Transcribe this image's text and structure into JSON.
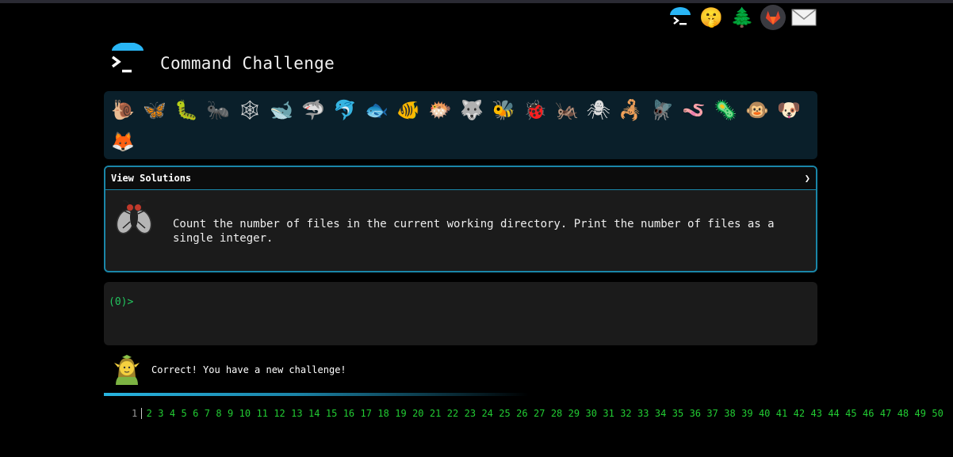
{
  "header": {
    "title": "Command Challenge",
    "top_icons": [
      "terminal-icon",
      "shushing-face-icon",
      "tree-icon",
      "gitlab-icon",
      "mail-icon"
    ]
  },
  "animals": [
    {
      "name": "snail",
      "glyph": "🐌"
    },
    {
      "name": "butterfly",
      "glyph": "🦋"
    },
    {
      "name": "caterpillar",
      "glyph": "🐛"
    },
    {
      "name": "ant",
      "glyph": "🐜"
    },
    {
      "name": "web",
      "glyph": "🕸"
    },
    {
      "name": "whale",
      "glyph": "🐋"
    },
    {
      "name": "shark",
      "glyph": "🦈"
    },
    {
      "name": "dolphin",
      "glyph": "🐬"
    },
    {
      "name": "fish",
      "glyph": "🐟"
    },
    {
      "name": "tropical-fish",
      "glyph": "🐠"
    },
    {
      "name": "blowfish",
      "glyph": "🐡"
    },
    {
      "name": "wolf",
      "glyph": "🐺"
    },
    {
      "name": "bee",
      "glyph": "🐝"
    },
    {
      "name": "ladybug",
      "glyph": "🐞"
    },
    {
      "name": "cricket",
      "glyph": "🦗"
    },
    {
      "name": "spider",
      "glyph": "🕷"
    },
    {
      "name": "scorpion",
      "glyph": "🦂"
    },
    {
      "name": "fly",
      "glyph": "🪰"
    },
    {
      "name": "worm",
      "glyph": "🪱"
    },
    {
      "name": "microbe",
      "glyph": "🦠"
    },
    {
      "name": "monkey",
      "glyph": "🐵"
    },
    {
      "name": "dog",
      "glyph": "🐶"
    },
    {
      "name": "fox",
      "glyph": "🦊"
    }
  ],
  "panel": {
    "heading": "View Solutions",
    "chevron": "❯",
    "challenge": "Count the number of files in the current working directory. Print the number of files as a single integer."
  },
  "terminal": {
    "prompt": "(0)>"
  },
  "status": {
    "message": "Correct! You have a new challenge!"
  },
  "progress": {
    "fraction": 0.6
  },
  "pages": [
    "1",
    "2",
    "3",
    "4",
    "5",
    "6",
    "7",
    "8",
    "9",
    "10",
    "11",
    "12",
    "13",
    "14",
    "15",
    "16",
    "17",
    "18",
    "19",
    "20",
    "21",
    "22",
    "23",
    "24",
    "25",
    "26",
    "27",
    "28",
    "29",
    "30",
    "31",
    "32",
    "33",
    "34",
    "35",
    "36",
    "37",
    "38",
    "39",
    "40",
    "41",
    "42",
    "43",
    "44",
    "45",
    "46",
    "47",
    "48",
    "49",
    "50"
  ],
  "current_page": "1"
}
